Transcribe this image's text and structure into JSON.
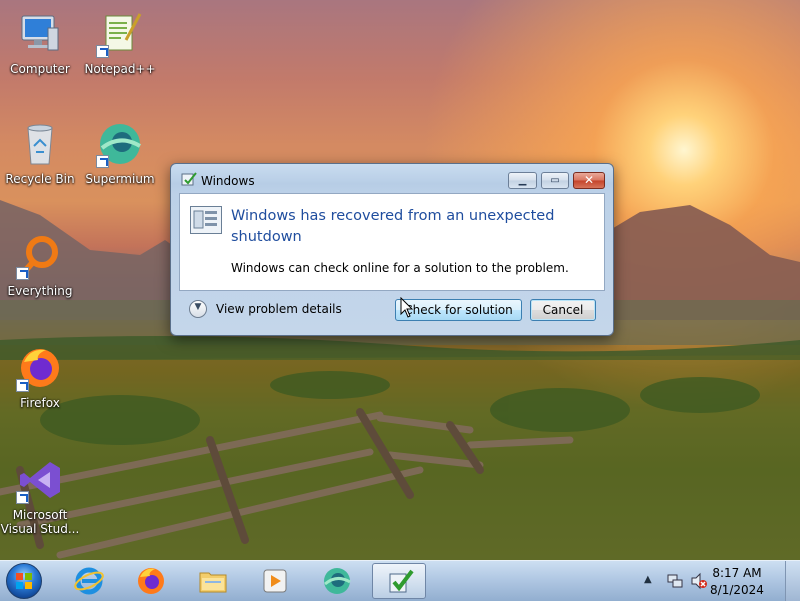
{
  "desktop": {
    "icons": [
      {
        "label": "Computer",
        "icon": "computer-icon"
      },
      {
        "label": "Notepad++",
        "icon": "notepadpp-icon"
      },
      {
        "label": "Recycle Bin",
        "icon": "recycle-bin-icon"
      },
      {
        "label": "Supermium",
        "icon": "supermium-icon"
      },
      {
        "label": "Everything",
        "icon": "everything-icon"
      },
      {
        "label": "Firefox",
        "icon": "firefox-icon"
      },
      {
        "label": "Microsoft Visual Stud...",
        "icon": "visual-studio-icon"
      }
    ]
  },
  "dialog": {
    "title": "Windows",
    "main_instruction": "Windows has recovered from an unexpected shutdown",
    "content": "Windows can check online for a solution to the problem.",
    "details_label": "View problem details",
    "check_button": "Check for solution",
    "cancel_button": "Cancel"
  },
  "taskbar": {
    "items": [
      "internet-explorer-icon",
      "firefox-icon",
      "file-explorer-icon",
      "media-player-icon",
      "supermium-icon",
      "problem-reporting-icon"
    ],
    "active_item": "problem-reporting-icon",
    "clock_time": "8:17 AM",
    "clock_date": "8/1/2024"
  },
  "colors": {
    "instruction_blue": "#1f4d9e",
    "taskbar": "#a9c1dd"
  }
}
